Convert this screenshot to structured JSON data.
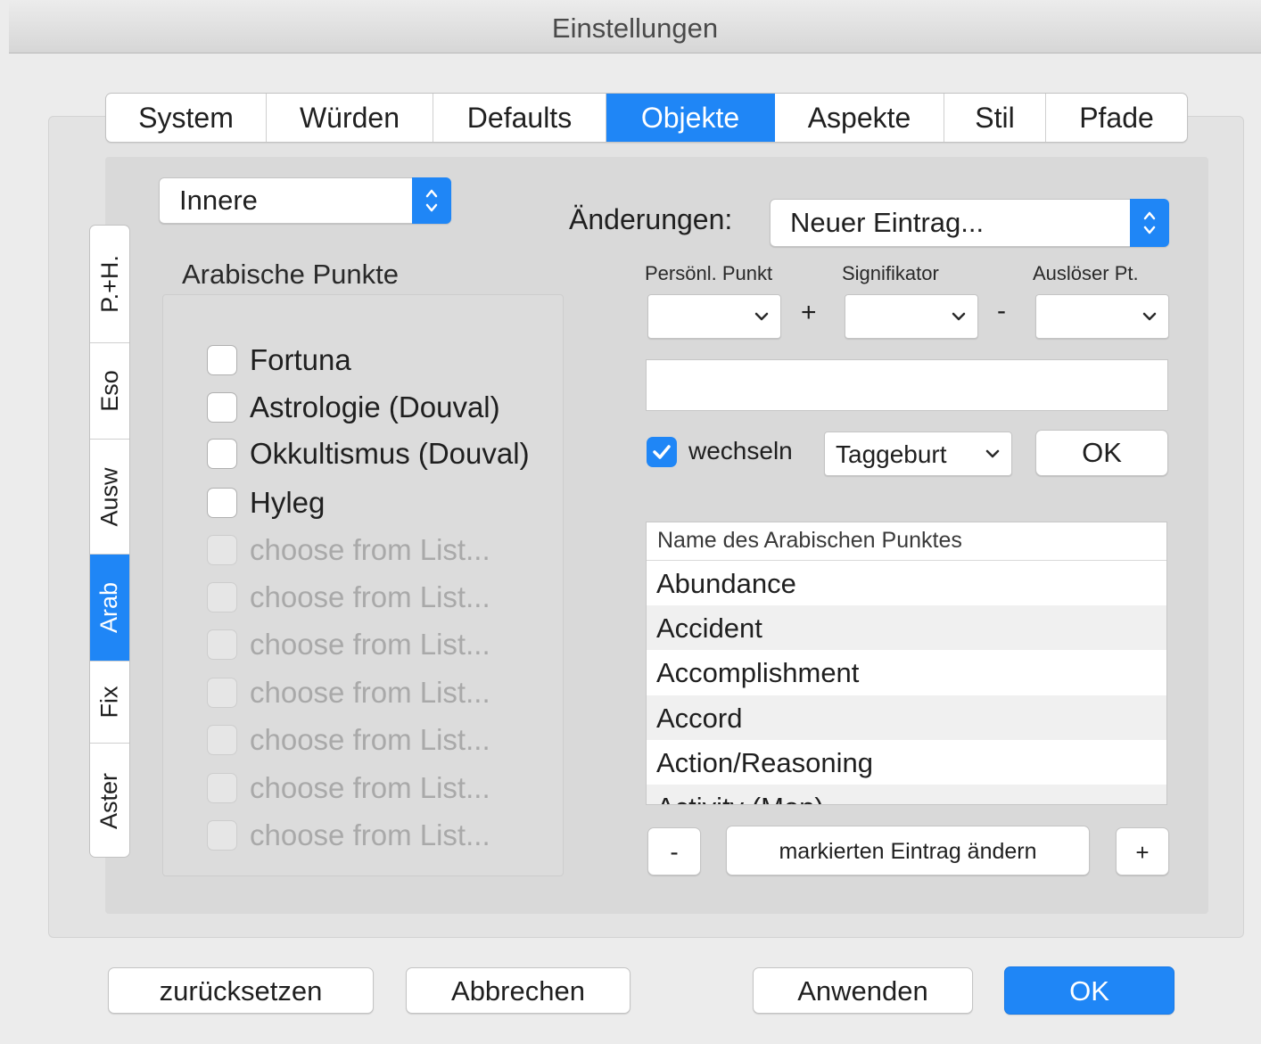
{
  "window": {
    "title": "Einstellungen"
  },
  "top_tabs": [
    {
      "label": "System",
      "selected": false
    },
    {
      "label": "Würden",
      "selected": false
    },
    {
      "label": "Defaults",
      "selected": false
    },
    {
      "label": "Objekte",
      "selected": true
    },
    {
      "label": "Aspekte",
      "selected": false
    },
    {
      "label": "Stil",
      "selected": false
    },
    {
      "label": "Pfade",
      "selected": false
    }
  ],
  "side_tabs": [
    {
      "label": "P.+H.",
      "selected": false
    },
    {
      "label": "Eso",
      "selected": false
    },
    {
      "label": "Ausw",
      "selected": false
    },
    {
      "label": "Arab",
      "selected": true
    },
    {
      "label": "Fix",
      "selected": false
    },
    {
      "label": "Aster",
      "selected": false
    }
  ],
  "left": {
    "category_popup": {
      "value": "Innere"
    },
    "section_label": "Arabische Punkte",
    "checkboxes": [
      {
        "label": "Fortuna",
        "checked": false,
        "enabled": true
      },
      {
        "label": "Astrologie (Douval)",
        "checked": false,
        "enabled": true
      },
      {
        "label": "Okkultismus (Douval)",
        "checked": false,
        "enabled": true
      },
      {
        "label": "Hyleg",
        "checked": false,
        "enabled": true
      },
      {
        "label": "choose from List...",
        "checked": false,
        "enabled": false
      },
      {
        "label": "choose from List...",
        "checked": false,
        "enabled": false
      },
      {
        "label": "choose from List...",
        "checked": false,
        "enabled": false
      },
      {
        "label": "choose from List...",
        "checked": false,
        "enabled": false
      },
      {
        "label": "choose from List...",
        "checked": false,
        "enabled": false
      },
      {
        "label": "choose from List...",
        "checked": false,
        "enabled": false
      },
      {
        "label": "choose from List...",
        "checked": false,
        "enabled": false
      }
    ]
  },
  "right": {
    "changes_label": "Änderungen:",
    "changes_popup": {
      "value": "Neuer Eintrag..."
    },
    "formula": {
      "col1_label": "Persönl. Punkt",
      "col2_label": "Signifikator",
      "col3_label": "Auslöser Pt.",
      "plus": "+",
      "minus": "-"
    },
    "formula_text": "",
    "switch_checkbox": {
      "label": "wechseln",
      "checked": true
    },
    "birth_popup": {
      "value": "Taggeburt"
    },
    "ok_small_label": "OK",
    "table": {
      "header": "Name des Arabischen Punktes",
      "rows": [
        "Abundance",
        "Accident",
        "Accomplishment",
        "Accord",
        "Action/Reasoning",
        "Activity (Men)"
      ]
    },
    "remove_label": "-",
    "edit_label": "markierten Eintrag ändern",
    "add_label": "+"
  },
  "footer": {
    "reset_label": "zurücksetzen",
    "cancel_label": "Abbrechen",
    "apply_label": "Anwenden",
    "ok_label": "OK"
  },
  "colors": {
    "accent": "#1f86f6",
    "panel": "#d9d9d9",
    "window": "#ececec"
  }
}
